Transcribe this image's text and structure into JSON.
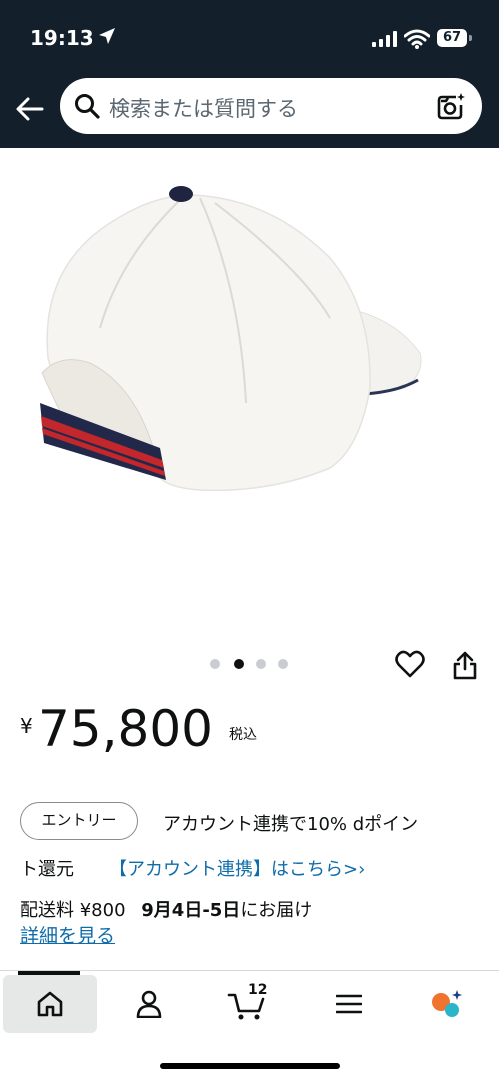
{
  "status_bar": {
    "time": "19:13",
    "battery": "67"
  },
  "search": {
    "placeholder": "検索または質問する"
  },
  "gallery": {
    "image_count": 4,
    "active_index": 1
  },
  "price": {
    "symbol": "¥",
    "value": "75,800",
    "tax_label": "税込"
  },
  "promo": {
    "entry_label": "エントリー",
    "line1": "アカウント連携で10% dポイン",
    "line2": "ト還元",
    "link": "【アカウント連携】はこちら>›"
  },
  "delivery": {
    "fee_text": "配送料 ¥800",
    "date": "9月4日-5日",
    "suffix": "にお届け",
    "details_link": "詳細を見る"
  },
  "tab_bar": {
    "cart_count": "12",
    "tabs": [
      "home",
      "account",
      "cart",
      "menu",
      "ai-assistant"
    ]
  }
}
